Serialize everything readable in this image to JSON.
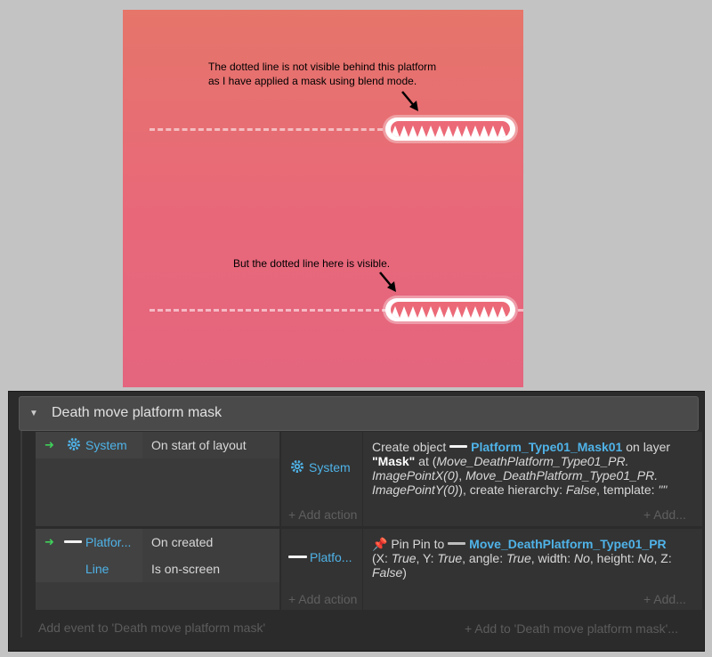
{
  "scene": {
    "top_note_line1": "The dotted line is not visible behind this platform",
    "top_note_line2": "as I have applied a mask using blend mode.",
    "bottom_note": "But the dotted line here is visible."
  },
  "group": {
    "title": "Death move platform mask"
  },
  "events": [
    {
      "conditions": [
        {
          "object": "System",
          "condition": "On start of layout"
        }
      ],
      "action_object": "System",
      "action": {
        "prefix": "Create object ",
        "object": "Platform_Type01_Mask01",
        "on_layer": " on layer ",
        "layer": "\"Mask\"",
        "at": " at (",
        "x_expr": "Move_DeathPlatform_Type01_PR.",
        "x_expr2": "ImagePointX(0)",
        "sep": ", ",
        "y_expr": "Move_DeathPlatform_Type01_PR.",
        "y_expr2": "ImagePointY(0)",
        "tail": "), create hierarchy: ",
        "hierarchy": "False",
        "template_label": ", template: ",
        "template": "\"\""
      },
      "add_action": "+ Add action",
      "add_more": "+ Add..."
    },
    {
      "conditions": [
        {
          "object": "Platfor...",
          "condition": "On created"
        },
        {
          "object": "Line",
          "condition": "Is on-screen"
        }
      ],
      "action_object": "Platfo...",
      "action": {
        "prefix": "Pin Pin to ",
        "target": "Move_DeathPlatform_Type01_PR",
        "open": "(X: ",
        "x": "True",
        "y_label": ", Y: ",
        "y": "True",
        "angle_label": ", angle: ",
        "angle": "True",
        "width_label": ", width: ",
        "width": "No",
        "height_label": ", height: ",
        "height": "No",
        "z_label": ", Z: ",
        "z": "False",
        "close": ")"
      },
      "add_action": "+ Add action",
      "add_more": "+ Add..."
    }
  ],
  "footer": {
    "add_event": "Add event to 'Death move platform mask'",
    "add_to": "+ Add to 'Death move platform mask'..."
  },
  "icons": {
    "gear": "gear-icon",
    "pin": "pin-icon",
    "arrow": "green-arrow-icon",
    "collapse": "triangle-down-icon"
  },
  "colors": {
    "accent": "#4fb3e8",
    "arrow": "#3fcf5a",
    "scene_top": "#e6756a",
    "scene_bottom": "#e4657e"
  }
}
